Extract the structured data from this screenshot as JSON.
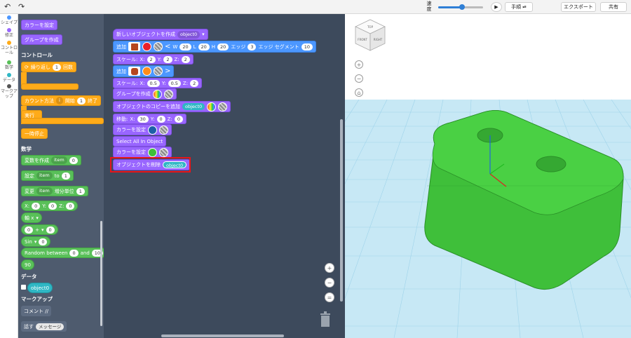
{
  "toolbar": {
    "speed_label": "速度",
    "speed_value": 0.52,
    "play_icon": "play-icon",
    "step_label": "手順",
    "export_label": "エクスポート",
    "share_label": "共有"
  },
  "categories": [
    {
      "label": "シェイプ",
      "color": "#4c97ff"
    },
    {
      "label": "修正",
      "color": "#9966ff"
    },
    {
      "label": "コントロール",
      "color": "#ffab19"
    },
    {
      "label": "数学",
      "color": "#59c059"
    },
    {
      "label": "データ",
      "color": "#2fb7c4"
    },
    {
      "label": "マークアップ",
      "color": "#555555"
    }
  ],
  "flyout": {
    "set_color": "カラーを設定",
    "create_group": "グループを作成",
    "control_header": "コントロール",
    "repeat": "繰り返し",
    "repeat_count": "1",
    "repeat_unit": "回数",
    "count_with": "カウント方法",
    "count_var": "i",
    "count_start": "開始",
    "count_start_val": "1",
    "count_end": "終了",
    "execute": "実行",
    "pause": "一時停止",
    "math_header": "数学",
    "create_var": "変数を作成",
    "create_var_name": "item",
    "create_var_val": "0",
    "set": "設定",
    "set_var": "item",
    "set_to": "to",
    "set_val": "1",
    "change": "変更",
    "change_var": "item",
    "change_unit": "増分単位",
    "change_val": "1",
    "x_label": "X:",
    "x_val": "0",
    "y_label": "Y:",
    "y_val": "0",
    "z_label": "Z:",
    "z_val": "0",
    "axis": "軸 x",
    "op_a": "0",
    "op": "+",
    "op_b": "0",
    "sin": "Sin",
    "sin_val": "0",
    "random_between": "Random between",
    "random_a": "0",
    "random_and": "and",
    "random_b": "10",
    "ninety": "90",
    "data_header": "データ",
    "object_var": "object0",
    "markup_header": "マークアップ",
    "comment": "コメント //",
    "say": "話す",
    "message": "メッセージ"
  },
  "workspace": {
    "new_object": "新しいオブジェクトを作成",
    "new_object_var": "object0",
    "add": "追加",
    "w": "W",
    "w_val": "20",
    "l": "L",
    "l_val": "20",
    "h": "H",
    "h_val": "20",
    "edge": "エッジ",
    "edge_val": "3",
    "edge_segment": "エッジ セグメント",
    "edge_segment_val": "10",
    "scale1": "スケール:",
    "scale1_x": "2",
    "scale1_y": "2",
    "scale1_z": "2",
    "add2": "追加",
    "scale2": "スケール:",
    "scale2_x": "0.5",
    "scale2_y": "0.5",
    "scale2_z": "2",
    "create_group": "グループを作成",
    "copy_add": "オブジェクトのコピーを追加",
    "copy_var": "object0",
    "move": "移動:",
    "move_x": "30",
    "move_y": "0",
    "move_z": "0",
    "set_color": "カラーを設定",
    "select_all": "Select All In Object",
    "set_color2": "カラーを設定",
    "delete_object": "オブジェクトを削除",
    "delete_var": "object0",
    "x": "X:",
    "y": "Y:",
    "z": "Z:"
  },
  "viewcube": {
    "top": "TOP",
    "front": "FRONT",
    "right": "RIGHT"
  },
  "colors": {
    "workspace_bg": "#3d4a5c",
    "flyout_bg": "#4e5b6e",
    "shape_green": "#3fbf3a",
    "grid_blue": "#b8dff0",
    "highlight_red": "#e8151b"
  }
}
